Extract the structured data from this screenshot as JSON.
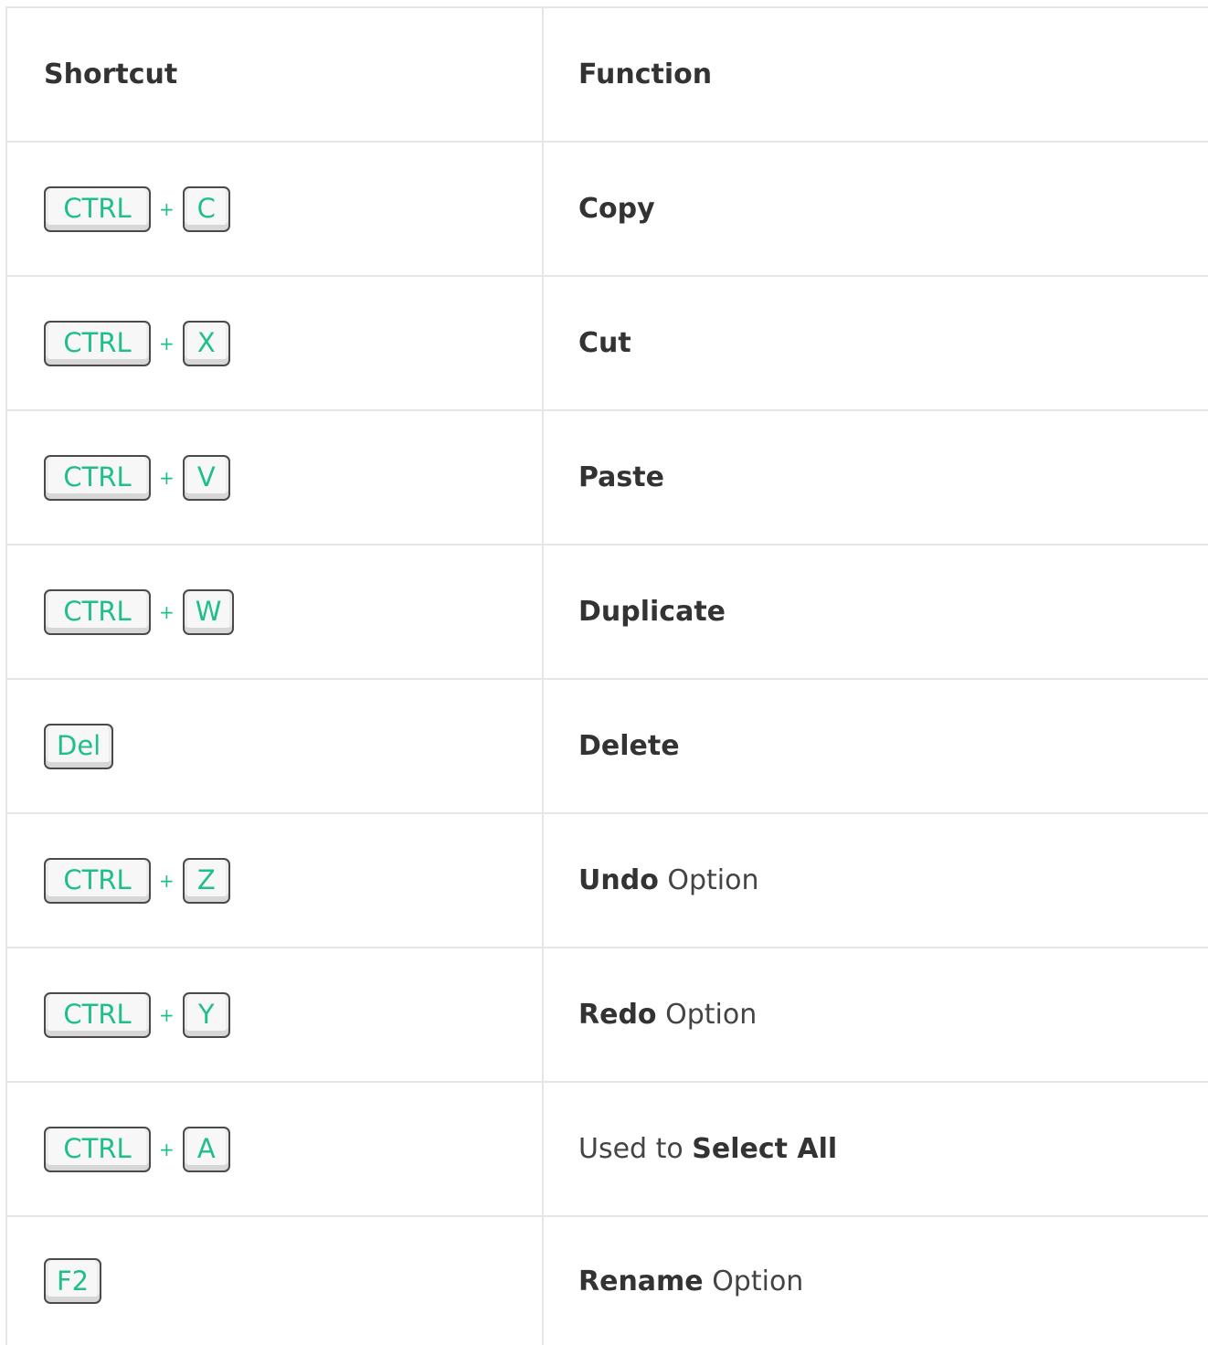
{
  "header": {
    "shortcut_label": "Shortcut",
    "function_label": "Function"
  },
  "rows": [
    {
      "keys": [
        "CTRL",
        "C"
      ],
      "plus": "+",
      "function_bold": "Copy",
      "function_prefix": "",
      "function_suffix": ""
    },
    {
      "keys": [
        "CTRL",
        "X"
      ],
      "plus": "+",
      "function_bold": "Cut",
      "function_prefix": "",
      "function_suffix": ""
    },
    {
      "keys": [
        "CTRL",
        "V"
      ],
      "plus": "+",
      "function_bold": "Paste",
      "function_prefix": "",
      "function_suffix": ""
    },
    {
      "keys": [
        "CTRL",
        "W"
      ],
      "plus": "+",
      "function_bold": "Duplicate",
      "function_prefix": "",
      "function_suffix": ""
    },
    {
      "keys": [
        "Del"
      ],
      "plus": "",
      "function_bold": "Delete",
      "function_prefix": "",
      "function_suffix": ""
    },
    {
      "keys": [
        "CTRL",
        "Z"
      ],
      "plus": "+",
      "function_bold": "Undo",
      "function_prefix": "",
      "function_suffix": " Option"
    },
    {
      "keys": [
        "CTRL",
        "Y"
      ],
      "plus": "+",
      "function_bold": "Redo",
      "function_prefix": "",
      "function_suffix": " Option"
    },
    {
      "keys": [
        "CTRL",
        "A"
      ],
      "plus": "+",
      "function_bold": "Select All",
      "function_prefix": "Used to ",
      "function_suffix": ""
    },
    {
      "keys": [
        "F2"
      ],
      "plus": "",
      "function_bold": "Rename",
      "function_prefix": "",
      "function_suffix": " Option"
    }
  ],
  "colors": {
    "key_text": "#1fbf88",
    "border": "#e6e6e6",
    "text": "#333333"
  }
}
